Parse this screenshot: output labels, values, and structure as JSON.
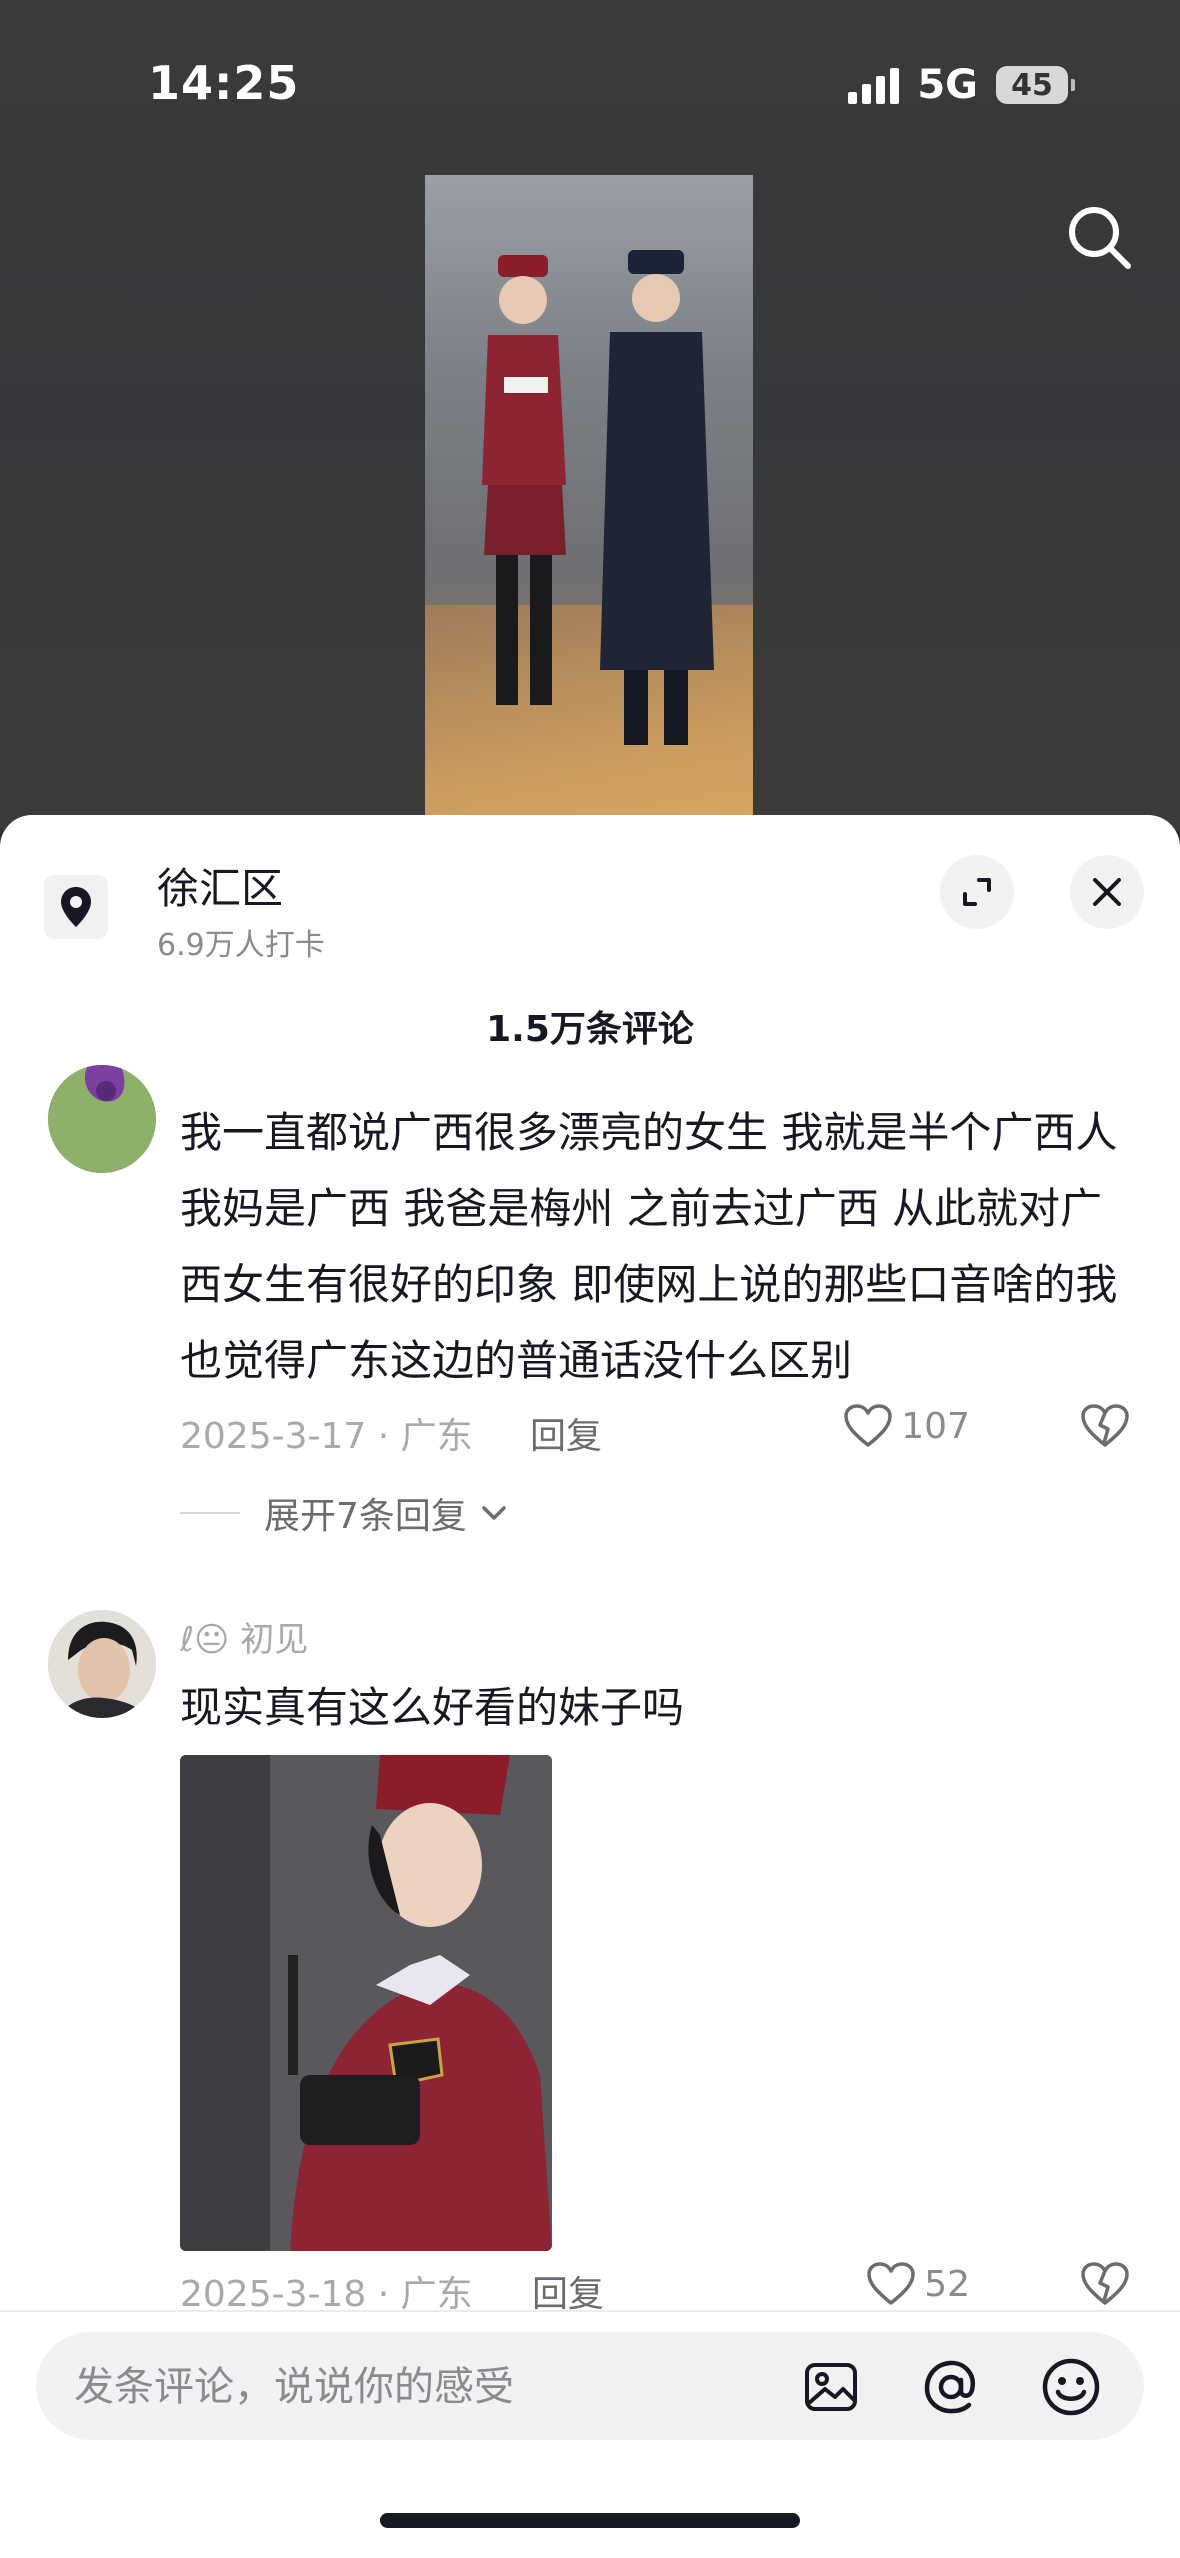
{
  "status_bar": {
    "time": "14:25",
    "network": "5G",
    "battery": "45"
  },
  "video": {
    "description_icon": "search-icon"
  },
  "location": {
    "name": "徐汇区",
    "checkins": "6.9万人打卡"
  },
  "comments_header": {
    "count_label": "1.5万条评论"
  },
  "comments": [
    {
      "text": "我一直都说广西很多漂亮的女生 我就是半个广西人 我妈是广西 我爸是梅州 之前去过广西 从此就对广西女生有很好的印象 即使网上说的那些口音啥的我也觉得广东这边的普通话没什么区别",
      "date_region": "2025-3-17 · 广东",
      "reply_label": "回复",
      "likes": "107",
      "expand_label": "展开7条回复"
    },
    {
      "nickname": "ℓ😐 初见",
      "text": "现实真有这么好看的妹子吗",
      "date_region": "2025-3-18 · 广东",
      "reply_label": "回复",
      "likes": "52"
    }
  ],
  "input": {
    "placeholder": "发条评论，说说你的感受"
  },
  "colors": {
    "text_primary": "#161823",
    "text_secondary": "#8a8b91",
    "sheet_bg": "#ffffff",
    "video_bg": "#3a3a3c"
  }
}
